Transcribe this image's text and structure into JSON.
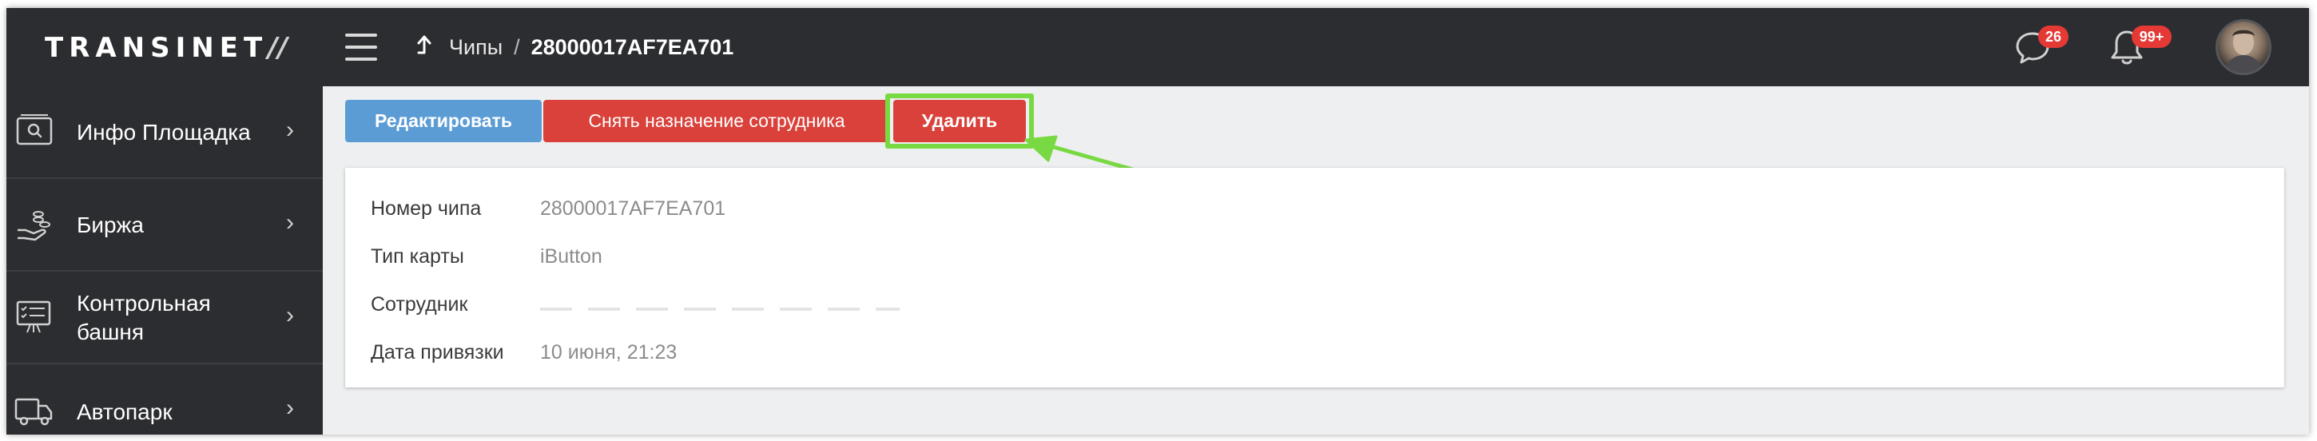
{
  "header": {
    "logo": "TRANSINET",
    "logo_slashes": "//",
    "breadcrumb_parent": "Чипы",
    "breadcrumb_separator": "/",
    "breadcrumb_current": "28000017AF7EA701",
    "chat_badge": "26",
    "notifications_badge": "99+",
    "icons": [
      "menu-icon",
      "arrow-up-icon",
      "chat-icon",
      "bell-icon"
    ]
  },
  "sidebar": {
    "items": [
      {
        "label": "Инфо Площадка",
        "icon": "monitor-search-icon"
      },
      {
        "label": "Биржа",
        "icon": "hand-coins-icon"
      },
      {
        "label": "Контрольная башня",
        "label_line1": "Контрольная",
        "label_line2": "башня",
        "icon": "control-board-icon"
      },
      {
        "label": "Автопарк",
        "icon": "truck-icon"
      }
    ]
  },
  "actions": {
    "edit": "Редактировать",
    "unassign": "Снять назначение сотрудника",
    "delete": "Удалить"
  },
  "details": {
    "chip_number_label": "Номер чипа",
    "chip_number_value": "28000017AF7EA701",
    "card_type_label": "Тип карты",
    "card_type_value": "iButton",
    "employee_label": "Сотрудник",
    "bind_date_label": "Дата привязки",
    "bind_date_value": "10 июня, 21:23"
  },
  "colors": {
    "topbar": "#2c2d30",
    "edit_button": "#5c9cd5",
    "danger_button": "#d9413a",
    "highlight": "#79d942",
    "badge": "#e53935"
  }
}
